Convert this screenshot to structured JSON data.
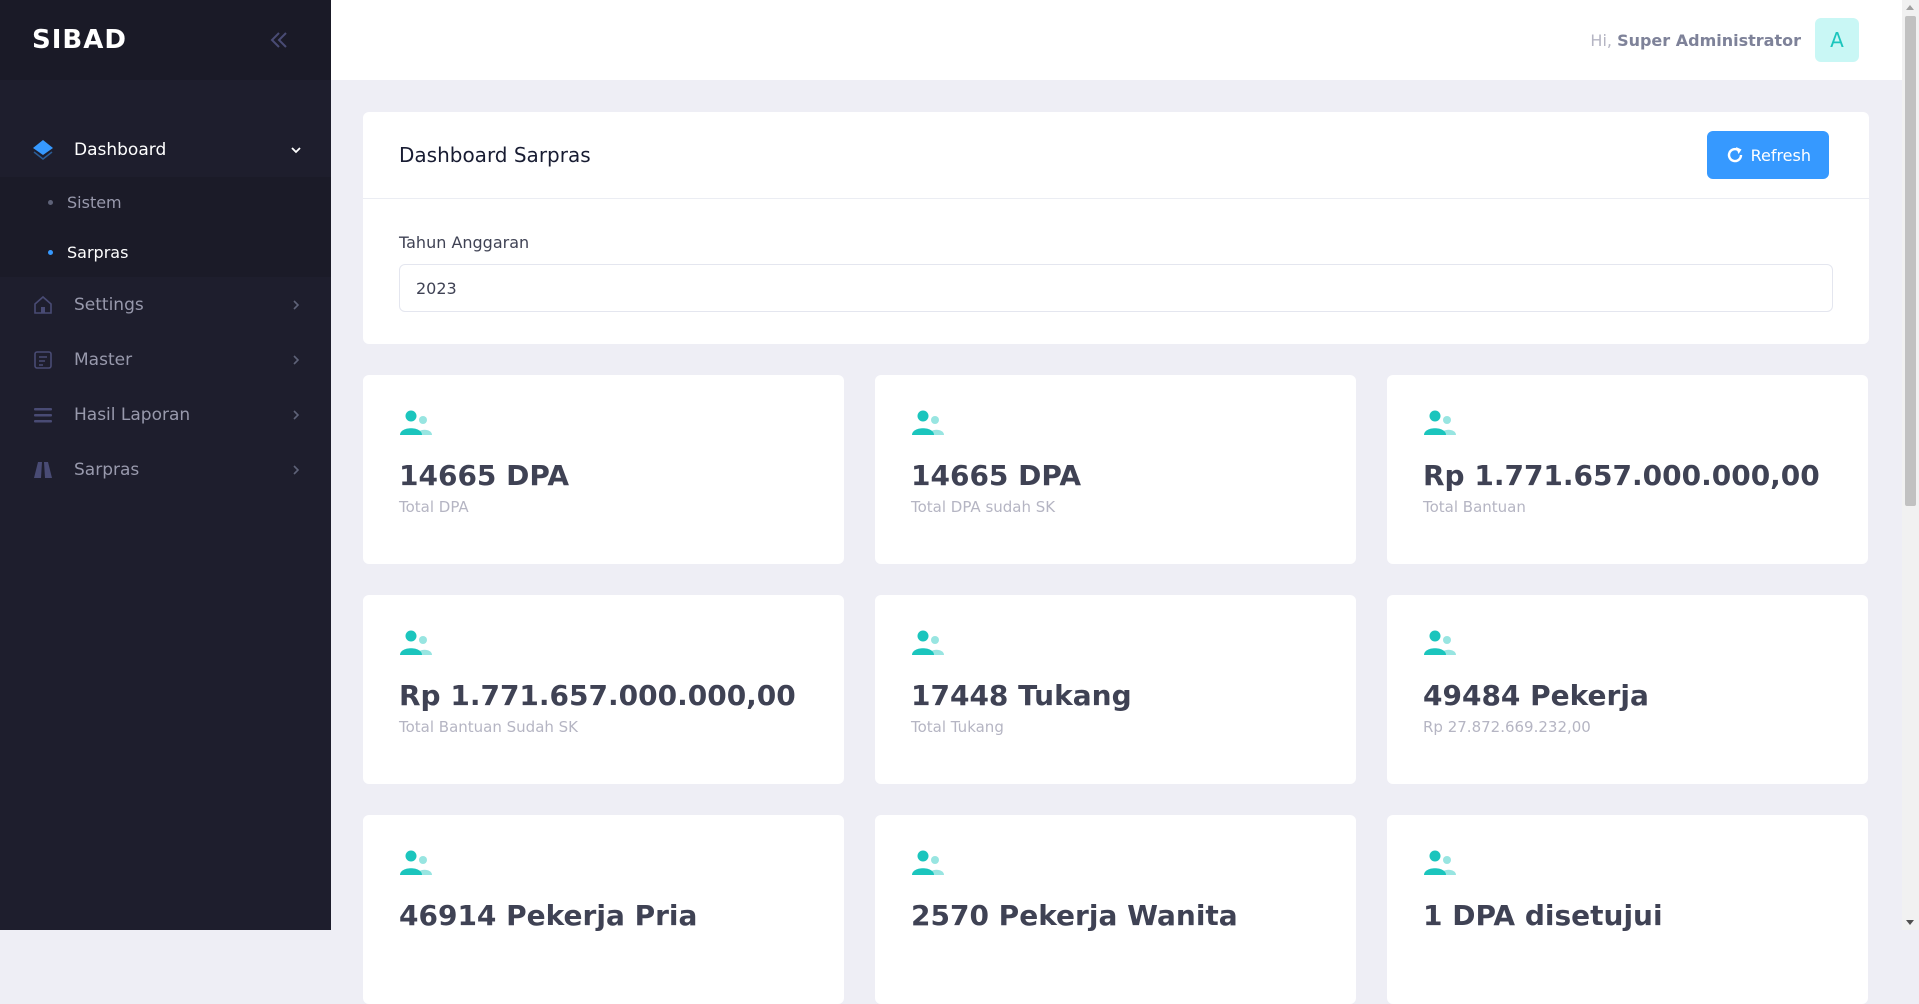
{
  "app": {
    "brand": "SIBAD"
  },
  "colors": {
    "sidebar_bg": "#1e1e2d",
    "accent": "#3699ff",
    "teal": "#1bc5bd",
    "page_bg": "#eeeef5"
  },
  "sidebar": {
    "items": [
      {
        "label": "Dashboard",
        "icon": "layers-icon",
        "active": true,
        "expanded": true,
        "children": [
          {
            "label": "Sistem",
            "active": false
          },
          {
            "label": "Sarpras",
            "active": true
          }
        ]
      },
      {
        "label": "Settings",
        "icon": "home-icon"
      },
      {
        "label": "Master",
        "icon": "clipboard-icon"
      },
      {
        "label": "Hasil Laporan",
        "icon": "list-icon"
      },
      {
        "label": "Sarpras",
        "icon": "road-icon"
      }
    ]
  },
  "header": {
    "greeting": "Hi,",
    "user_name": "Super Administrator",
    "avatar_letter": "A"
  },
  "panel": {
    "title": "Dashboard Sarpras",
    "refresh_label": "Refresh",
    "year_label": "Tahun Anggaran",
    "year_value": "2023"
  },
  "stats": [
    {
      "value": "14665 DPA",
      "label": "Total DPA"
    },
    {
      "value": "14665 DPA",
      "label": "Total DPA sudah SK"
    },
    {
      "value": "Rp 1.771.657.000.000,00",
      "label": "Total Bantuan"
    },
    {
      "value": "Rp 1.771.657.000.000,00",
      "label": "Total Bantuan Sudah SK"
    },
    {
      "value": "17448 Tukang",
      "label": "Total Tukang"
    },
    {
      "value": "49484 Pekerja",
      "label": "Rp 27.872.669.232,00"
    },
    {
      "value": "46914 Pekerja Pria",
      "label": ""
    },
    {
      "value": "2570 Pekerja Wanita",
      "label": ""
    },
    {
      "value": "1 DPA disetujui",
      "label": ""
    }
  ]
}
